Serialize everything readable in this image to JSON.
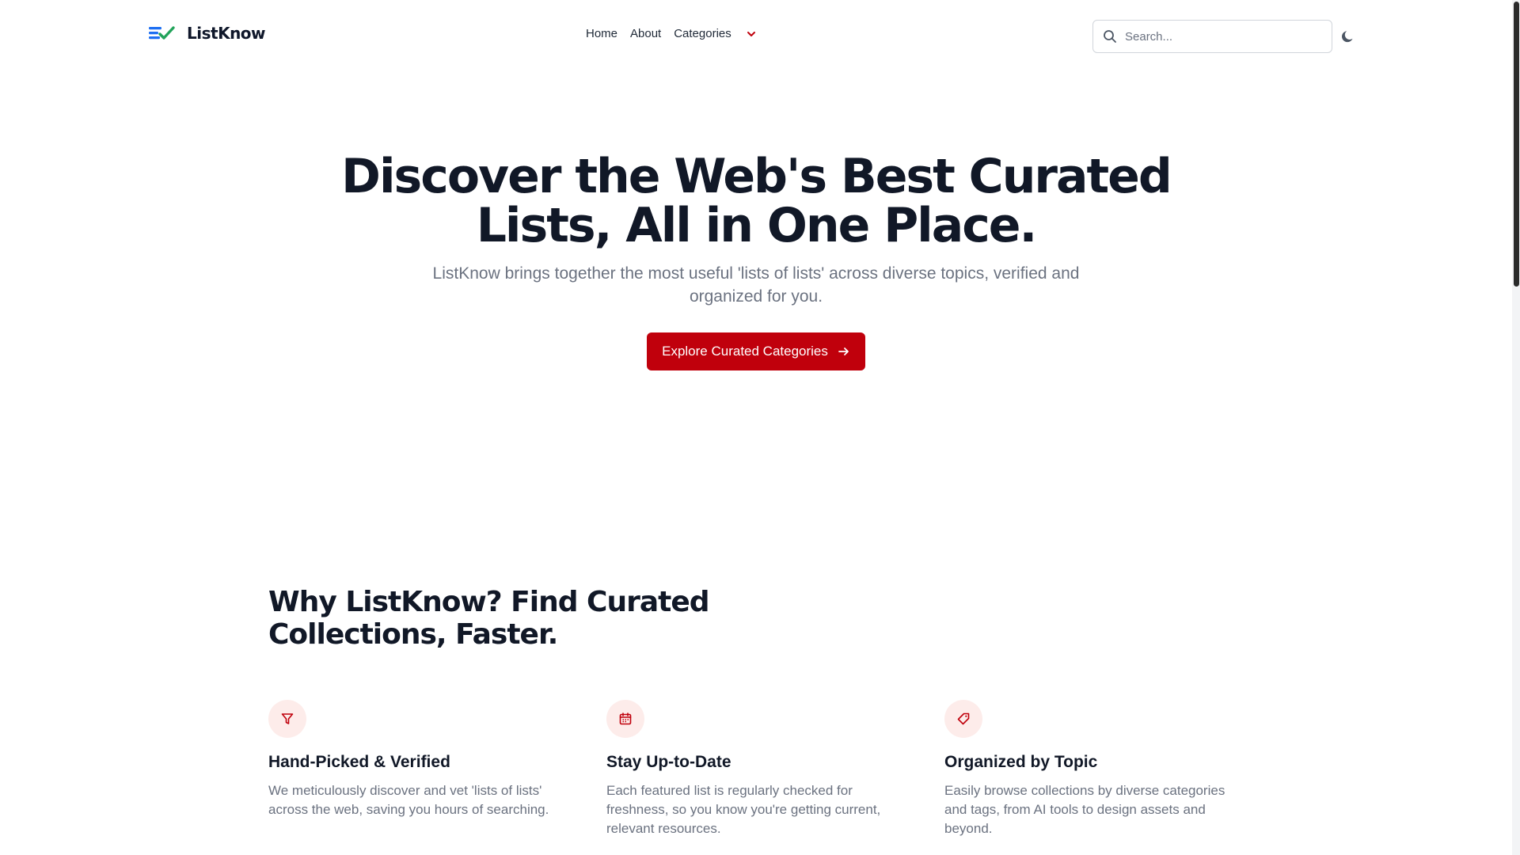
{
  "header": {
    "logo_text": "ListKnow",
    "nav": {
      "home": "Home",
      "about": "About",
      "categories": "Categories"
    },
    "search": {
      "placeholder": "Search..."
    },
    "theme_toggle_icon": "moon-icon"
  },
  "hero": {
    "title": "Discover the Web's Best Curated Lists, All in One Place.",
    "subtitle": "ListKnow brings together the most useful 'lists of lists' across diverse topics, verified and organized for you.",
    "cta_label": "Explore Curated Categories"
  },
  "why": {
    "title": "Why ListKnow? Find Curated Collections, Faster.",
    "features": [
      {
        "icon": "filter-icon",
        "title": "Hand-Picked & Verified",
        "text": "We meticulously discover and vet 'lists of lists' across the web, saving you hours of searching."
      },
      {
        "icon": "calendar-icon",
        "title": "Stay Up-to-Date",
        "text": "Each featured list is regularly checked for freshness, so you know you're getting current, relevant resources."
      },
      {
        "icon": "tag-icon",
        "title": "Organized by Topic",
        "text": "Easily browse collections by diverse categories and tags, from AI tools to design assets and beyond."
      }
    ]
  },
  "colors": {
    "accent": "#c0000c",
    "icon_bg": "#fdecea",
    "text_dark": "#111827",
    "text_muted": "#6b7280",
    "logo_blue": "#1d6ff2",
    "logo_green": "#22a35a"
  }
}
